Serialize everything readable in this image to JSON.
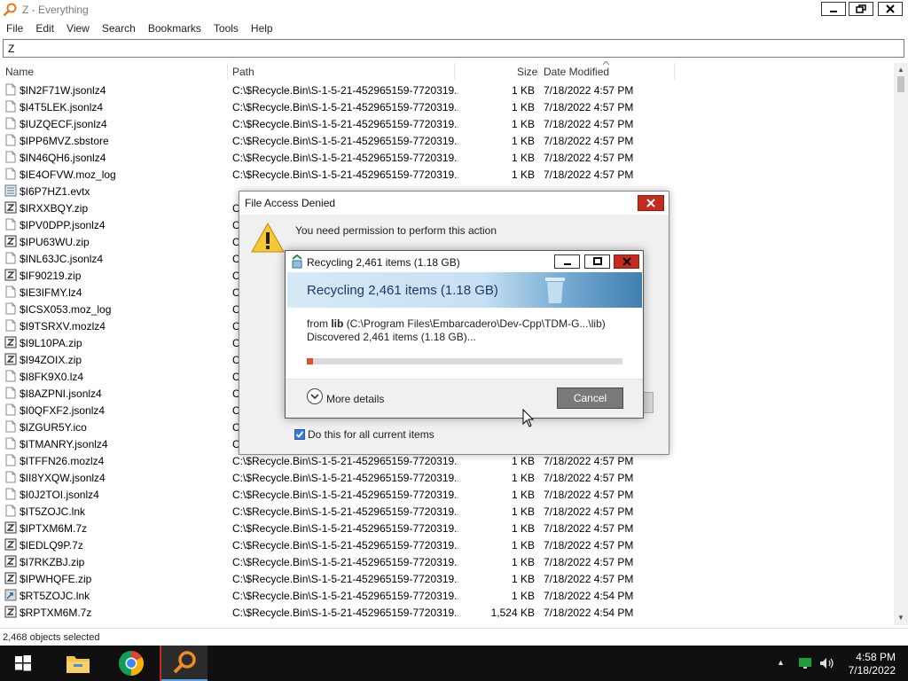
{
  "window": {
    "title": "Z - Everything"
  },
  "menu": [
    "File",
    "Edit",
    "View",
    "Search",
    "Bookmarks",
    "Tools",
    "Help"
  ],
  "search": {
    "value": "Z"
  },
  "columns": {
    "name": "Name",
    "path": "Path",
    "size": "Size",
    "date": "Date Modified"
  },
  "rows": [
    {
      "name": "$IN2F71W.jsonlz4",
      "path": "C:\\$Recycle.Bin\\S-1-5-21-452965159-7720319...",
      "size": "1 KB",
      "date": "7/18/2022 4:57 PM",
      "icon": "file"
    },
    {
      "name": "$I4T5LEK.jsonlz4",
      "path": "C:\\$Recycle.Bin\\S-1-5-21-452965159-7720319...",
      "size": "1 KB",
      "date": "7/18/2022 4:57 PM",
      "icon": "file"
    },
    {
      "name": "$IUZQECF.jsonlz4",
      "path": "C:\\$Recycle.Bin\\S-1-5-21-452965159-7720319...",
      "size": "1 KB",
      "date": "7/18/2022 4:57 PM",
      "icon": "file"
    },
    {
      "name": "$IPP6MVZ.sbstore",
      "path": "C:\\$Recycle.Bin\\S-1-5-21-452965159-7720319...",
      "size": "1 KB",
      "date": "7/18/2022 4:57 PM",
      "icon": "file"
    },
    {
      "name": "$IN46QH6.jsonlz4",
      "path": "C:\\$Recycle.Bin\\S-1-5-21-452965159-7720319...",
      "size": "1 KB",
      "date": "7/18/2022 4:57 PM",
      "icon": "file"
    },
    {
      "name": "$IE4OFVW.moz_log",
      "path": "C:\\$Recycle.Bin\\S-1-5-21-452965159-7720319...",
      "size": "1 KB",
      "date": "7/18/2022 4:57 PM",
      "icon": "file"
    },
    {
      "name": "$I6P7HZ1.evtx",
      "path": "",
      "size": "",
      "date": "",
      "icon": "evtx"
    },
    {
      "name": "$IRXXBQY.zip",
      "path": "C",
      "size": "",
      "date": "",
      "icon": "zip"
    },
    {
      "name": "$IPV0DPP.jsonlz4",
      "path": "C",
      "size": "",
      "date": "",
      "icon": "file"
    },
    {
      "name": "$IPU63WU.zip",
      "path": "C",
      "size": "",
      "date": "",
      "icon": "zip"
    },
    {
      "name": "$INL63JC.jsonlz4",
      "path": "C",
      "size": "",
      "date": "",
      "icon": "file"
    },
    {
      "name": "$IF90219.zip",
      "path": "C",
      "size": "",
      "date": "",
      "icon": "zip"
    },
    {
      "name": "$IE3IFMY.lz4",
      "path": "C",
      "size": "",
      "date": "",
      "icon": "file"
    },
    {
      "name": "$ICSX053.moz_log",
      "path": "C",
      "size": "",
      "date": "",
      "icon": "file"
    },
    {
      "name": "$I9TSRXV.mozlz4",
      "path": "C",
      "size": "",
      "date": "",
      "icon": "file"
    },
    {
      "name": "$I9L10PA.zip",
      "path": "C",
      "size": "",
      "date": "",
      "icon": "zip"
    },
    {
      "name": "$I94ZOIX.zip",
      "path": "C",
      "size": "",
      "date": "",
      "icon": "zip"
    },
    {
      "name": "$I8FK9X0.lz4",
      "path": "C",
      "size": "",
      "date": "",
      "icon": "file"
    },
    {
      "name": "$I8AZPNI.jsonlz4",
      "path": "C",
      "size": "",
      "date": "",
      "icon": "file"
    },
    {
      "name": "$I0QFXF2.jsonlz4",
      "path": "C",
      "size": "",
      "date": "",
      "icon": "file"
    },
    {
      "name": "$IZGUR5Y.ico",
      "path": "C",
      "size": "",
      "date": "",
      "icon": "file"
    },
    {
      "name": "$ITMANRY.jsonlz4",
      "path": "C",
      "size": "",
      "date": "",
      "icon": "file"
    },
    {
      "name": "$ITFFN26.mozlz4",
      "path": "C:\\$Recycle.Bin\\S-1-5-21-452965159-7720319...",
      "size": "1 KB",
      "date": "7/18/2022 4:57 PM",
      "icon": "file"
    },
    {
      "name": "$II8YXQW.jsonlz4",
      "path": "C:\\$Recycle.Bin\\S-1-5-21-452965159-7720319...",
      "size": "1 KB",
      "date": "7/18/2022 4:57 PM",
      "icon": "file"
    },
    {
      "name": "$I0J2TOI.jsonlz4",
      "path": "C:\\$Recycle.Bin\\S-1-5-21-452965159-7720319...",
      "size": "1 KB",
      "date": "7/18/2022 4:57 PM",
      "icon": "file"
    },
    {
      "name": "$IT5ZOJC.lnk",
      "path": "C:\\$Recycle.Bin\\S-1-5-21-452965159-7720319...",
      "size": "1 KB",
      "date": "7/18/2022 4:57 PM",
      "icon": "file"
    },
    {
      "name": "$IPTXM6M.7z",
      "path": "C:\\$Recycle.Bin\\S-1-5-21-452965159-7720319...",
      "size": "1 KB",
      "date": "7/18/2022 4:57 PM",
      "icon": "zip"
    },
    {
      "name": "$IEDLQ9P.7z",
      "path": "C:\\$Recycle.Bin\\S-1-5-21-452965159-7720319...",
      "size": "1 KB",
      "date": "7/18/2022 4:57 PM",
      "icon": "zip"
    },
    {
      "name": "$I7RKZBJ.zip",
      "path": "C:\\$Recycle.Bin\\S-1-5-21-452965159-7720319...",
      "size": "1 KB",
      "date": "7/18/2022 4:57 PM",
      "icon": "zip"
    },
    {
      "name": "$IPWHQFE.zip",
      "path": "C:\\$Recycle.Bin\\S-1-5-21-452965159-7720319...",
      "size": "1 KB",
      "date": "7/18/2022 4:57 PM",
      "icon": "zip"
    },
    {
      "name": "$RT5ZOJC.lnk",
      "path": "C:\\$Recycle.Bin\\S-1-5-21-452965159-7720319...",
      "size": "1 KB",
      "date": "7/18/2022 4:54 PM",
      "icon": "lnk"
    },
    {
      "name": "$RPTXM6M.7z",
      "path": "C:\\$Recycle.Bin\\S-1-5-21-452965159-7720319...",
      "size": "1,524 KB",
      "date": "7/18/2022 4:54 PM",
      "icon": "zip"
    }
  ],
  "status": {
    "text": "2,468 objects selected"
  },
  "access_denied": {
    "title": "File Access Denied",
    "message": "You need permission to perform this action",
    "checkbox_label": "Do this for all current items",
    "checked": true
  },
  "recycling": {
    "title": "Recycling 2,461 items (1.18 GB)",
    "banner": "Recycling 2,461 items (1.18 GB)",
    "from_prefix": "from ",
    "from_folder": "lib",
    "from_path": "(C:\\Program Files\\Embarcadero\\Dev-Cpp\\TDM-G...\\lib)",
    "discovered": "Discovered 2,461 items (1.18 GB)...",
    "progress_percent": 2,
    "more_details": "More details",
    "cancel": "Cancel"
  },
  "taskbar": {
    "time": "4:58 PM",
    "date": "7/18/2022",
    "apps": [
      "start-icon",
      "file-explorer-icon",
      "chrome-icon",
      "everything-search-icon"
    ]
  },
  "colors": {
    "accent_red": "#c42b1c",
    "progress": "#e05030",
    "taskbar": "#101010"
  }
}
